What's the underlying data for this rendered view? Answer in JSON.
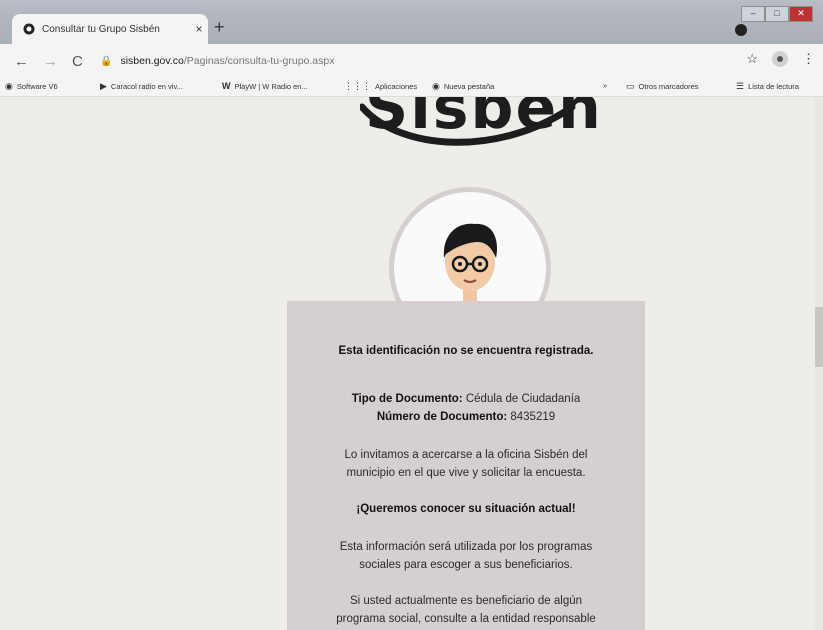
{
  "window": {
    "tab_title": "Consultar tu Grupo Sisbén",
    "tab_close": "×",
    "new_tab": "+"
  },
  "address": {
    "host": "sisben.gov.co",
    "path": "/Paginas/consulta-tu-grupo.aspx"
  },
  "bookmarks": {
    "items": [
      {
        "label": "Software V6"
      },
      {
        "label": "Caracol radio en viv..."
      },
      {
        "label": "PlayW | W Radio en..."
      },
      {
        "label": "Aplicaciones"
      },
      {
        "label": "Nueva pestaña"
      }
    ],
    "more": "»",
    "other": "Otros marcadores",
    "reading_list": "Lista de lectura"
  },
  "page": {
    "logo_text": "Sisben",
    "not_registered": "Esta identificación no se encuentra registrada.",
    "doc_type_label": "Tipo de Documento:",
    "doc_type_value": "Cédula de Ciudadanía",
    "doc_number_label": "Número de Documento:",
    "doc_number_value": "8435219",
    "invite_line1": "Lo invitamos a acercarse a la oficina Sisbén del",
    "invite_line2": "municipio en el que vive y solicitar la encuesta.",
    "headline": "¡Queremos conocer su situación actual!",
    "info_line1": "Esta información será utilizada por los programas",
    "info_line2": "sociales para escoger a sus beneficiarios.",
    "benef_line1": "Si usted actualmente es beneficiario de algún",
    "benef_line2": "programa social, consulte a la entidad responsable"
  },
  "colors": {
    "card_bg": "#d6cfcf",
    "accent_dark": "#1d1d1d"
  }
}
